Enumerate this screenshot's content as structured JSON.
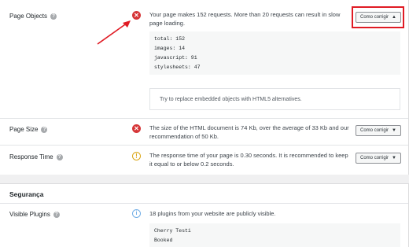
{
  "rows": {
    "page_objects": {
      "label": "Page Objects",
      "status_icon": "error-icon",
      "message": "Your page makes 152 requests. More than 20 requests can result in slow page loading.",
      "button_label": "Como corrigir",
      "button_caret": "▲",
      "code_lines": [
        "total: 152",
        "images: 14",
        "javascript: 91",
        "stylesheets: 47"
      ],
      "tip": "Try to replace embedded objects with HTML5 alternatives."
    },
    "page_size": {
      "label": "Page Size",
      "status_icon": "error-icon",
      "message": "The size of the HTML document is 74 Kb, over the average of 33 Kb and our recommendation of 50 Kb.",
      "button_label": "Como corrigir",
      "button_caret": "▼"
    },
    "response_time": {
      "label": "Response Time",
      "status_icon": "warning-icon",
      "message": "The response time of your page is 0.30 seconds. It is recommended to keep it equal to or below 0.2 seconds.",
      "button_label": "Como corrigir",
      "button_caret": "▼"
    }
  },
  "security": {
    "title": "Segurança",
    "visible_plugins": {
      "label": "Visible Plugins",
      "status_icon": "info-icon",
      "message": "18 plugins from your website are publicly visible.",
      "code_lines": [
        "Cherry Testi",
        "Booked"
      ]
    }
  },
  "colors": {
    "error": "#d63638",
    "warning": "#dba617",
    "info": "#72aee6",
    "highlight": "#e01b24"
  }
}
